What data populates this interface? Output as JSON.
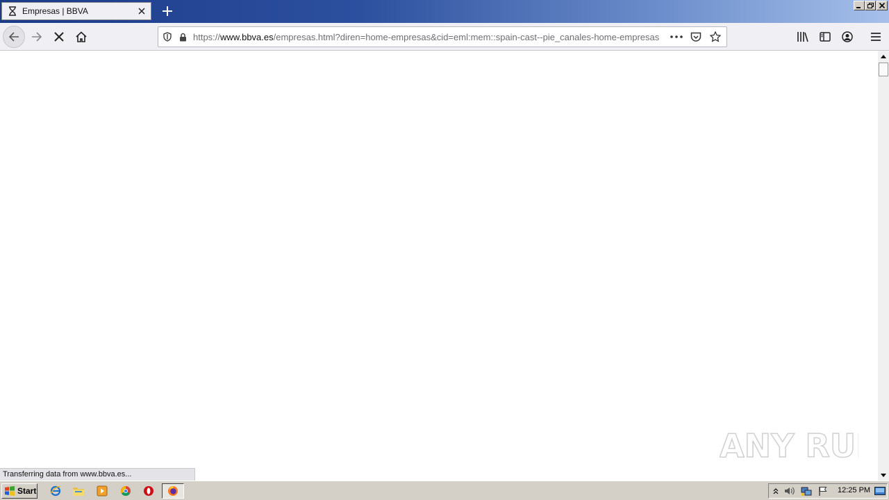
{
  "browser": {
    "tab": {
      "title": "Empresas | BBVA",
      "favicon": "hourglass-icon"
    },
    "url": {
      "scheme": "https://",
      "host": "www.bbva.es",
      "path": "/empresas.html?diren=home-empresas&cid=eml:mem::spain-cast--pie_canales-home-empresas"
    },
    "status_text": "Transferring data from www.bbva.es..."
  },
  "watermark": {
    "text": "ANY RUN"
  },
  "taskbar": {
    "start_label": "Start",
    "clock": "12:25 PM",
    "quick_launch": [
      "internet-explorer-icon",
      "explorer-folder-icon",
      "media-player-icon",
      "chrome-icon",
      "opera-icon"
    ],
    "active_task": "firefox-icon"
  },
  "colors": {
    "titlebar_start": "#1c3b8a",
    "titlebar_end": "#a6c0ea",
    "toolbar_bg": "#f0f0f4",
    "taskbar_bg": "#d4d0c8"
  }
}
